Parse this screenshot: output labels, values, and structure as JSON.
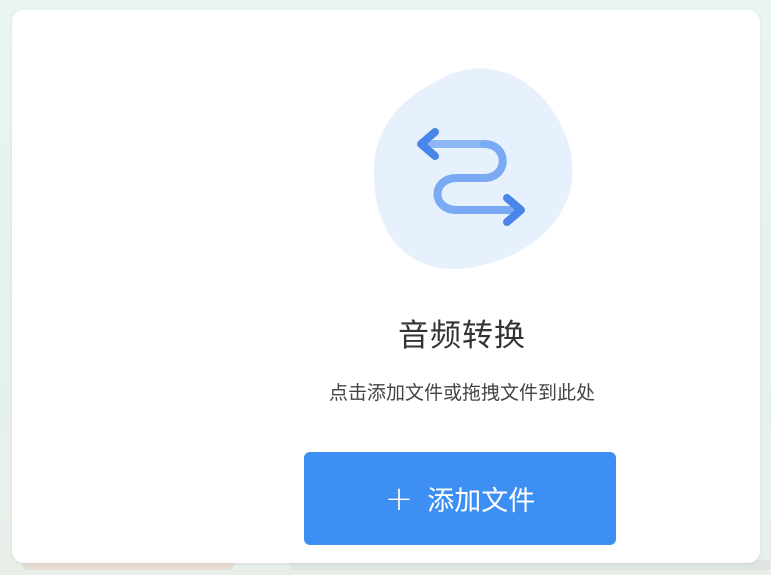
{
  "converter": {
    "title": "音频转换",
    "hint": "点击添加文件或拖拽文件到此处",
    "add_button": {
      "label": "添加文件",
      "icon": "plus-icon"
    },
    "illustration_icon": "swap-arrows-icon"
  },
  "colors": {
    "accent": "#3e8ff3",
    "illustration_bg": "#e7f0fd",
    "arrow_dark": "#4a86ea",
    "arrow_light": "#8fb8f6"
  }
}
